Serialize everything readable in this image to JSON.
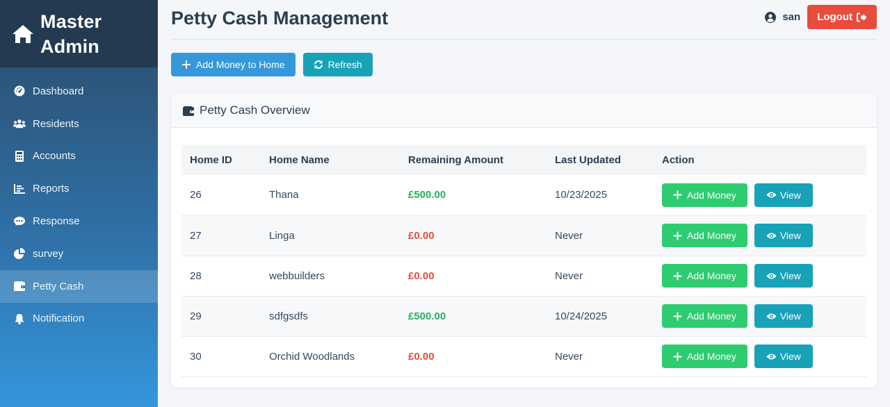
{
  "sidebar": {
    "brand_line1": "Master",
    "brand_line2": "Admin",
    "items": [
      {
        "label": "Dashboard",
        "icon": "gauge-icon"
      },
      {
        "label": "Residents",
        "icon": "users-icon"
      },
      {
        "label": "Accounts",
        "icon": "calculator-icon"
      },
      {
        "label": "Reports",
        "icon": "chart-icon"
      },
      {
        "label": "Response",
        "icon": "comment-icon"
      },
      {
        "label": "survey",
        "icon": "pie-icon"
      },
      {
        "label": "Petty Cash",
        "icon": "wallet-icon",
        "active": true
      },
      {
        "label": "Notification",
        "icon": "bell-icon"
      }
    ]
  },
  "header": {
    "title": "Petty Cash Management",
    "username": "san",
    "logout_label": "Logout"
  },
  "actions": {
    "add_money_home": "Add Money to Home",
    "refresh": "Refresh"
  },
  "overview": {
    "title": "Petty Cash Overview",
    "columns": [
      "Home ID",
      "Home Name",
      "Remaining Amount",
      "Last Updated",
      "Action"
    ],
    "add_money_label": "Add Money",
    "view_label": "View",
    "rows": [
      {
        "id": "26",
        "name": "Thana",
        "amount": "£500.00",
        "updated": "10/23/2025",
        "positive": true
      },
      {
        "id": "27",
        "name": "Linga",
        "amount": "£0.00",
        "updated": "Never",
        "positive": false
      },
      {
        "id": "28",
        "name": "webbuilders",
        "amount": "£0.00",
        "updated": "Never",
        "positive": false
      },
      {
        "id": "29",
        "name": "sdfgsdfs",
        "amount": "£500.00",
        "updated": "10/24/2025",
        "positive": true
      },
      {
        "id": "30",
        "name": "Orchid Woodlands",
        "amount": "£0.00",
        "updated": "Never",
        "positive": false
      }
    ]
  },
  "colors": {
    "sidebar_top": "#233a50",
    "primary": "#3498db",
    "info": "#17a2b8",
    "success": "#2ecc71",
    "danger": "#e74c3c",
    "amount_positive": "#27ae60"
  }
}
